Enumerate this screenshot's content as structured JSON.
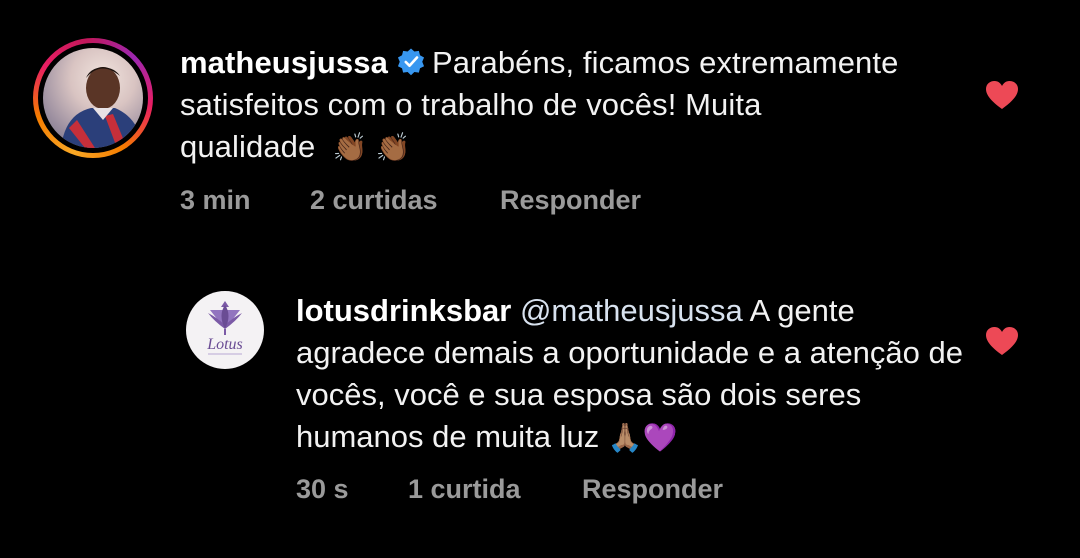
{
  "comment": {
    "username": "matheusjussa",
    "verified": true,
    "text": "Parabéns, ficamos extremamente satisfeitos com o trabalho de vocês! Muita qualidade",
    "emojis": "👏🏾 👏🏾",
    "time": "3 min",
    "likes": "2 curtidas",
    "reply_label": "Responder",
    "liked": true
  },
  "reply": {
    "username": "lotusdrinksbar",
    "mention": "@matheusjussa",
    "text": "A gente agradece demais a oportunidade e a atenção de vocês, você e sua esposa são dois seres humanos de muita luz",
    "emojis": "🙏🏽💜",
    "time": "30 s",
    "likes": "1 curtida",
    "reply_label": "Responder",
    "liked": true,
    "avatar_logo_text": "Lotus"
  },
  "colors": {
    "background": "#000000",
    "text": "#f2f2f2",
    "meta": "#9a9a9a",
    "heart": "#ed4956",
    "verified": "#3897f0",
    "mention": "#d8e2ef",
    "lotus_purple": "#7b5aa6"
  },
  "icons": {
    "verified": "verified-badge-icon",
    "like": "heart-icon"
  }
}
